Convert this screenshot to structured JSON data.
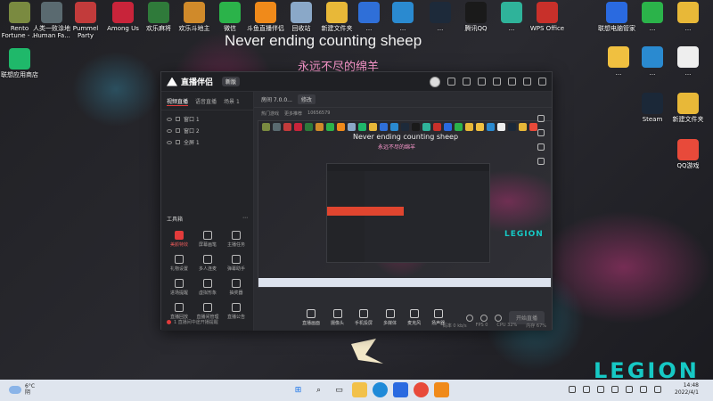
{
  "desktop": {
    "banner_en": "Never ending counting sheep",
    "banner_cn": "永远不尽的绵羊",
    "brand": "LEGION",
    "icons_left": [
      {
        "label": "Rento Fortune - ...",
        "icon": "rento-fortune-icon",
        "color": "#7a8a40"
      },
      {
        "label": "人类一败涂地 Human Fa...",
        "icon": "human-fall-flat-icon",
        "color": "#5a6a70"
      },
      {
        "label": "Pummel Party",
        "icon": "pummel-party-icon",
        "color": "#c23b3b"
      },
      {
        "label": "Among Us",
        "icon": "among-us-icon",
        "color": "#c8243a"
      },
      {
        "label": "欢乐麻将",
        "icon": "mahjong-icon",
        "color": "#2f7a3a"
      },
      {
        "label": "欢乐斗地主",
        "icon": "doudizhu-icon",
        "color": "#d08a2a"
      },
      {
        "label": "微信",
        "icon": "wechat-icon",
        "color": "#2bb34a"
      },
      {
        "label": "斗鱼直播伴侣",
        "icon": "douyu-icon",
        "color": "#f08a1a"
      },
      {
        "label": "回收站",
        "icon": "recycle-bin-icon",
        "color": "#8aa8c8"
      },
      {
        "label": "联想应用商店",
        "icon": "lenovo-store-icon",
        "color": "#1fb86a"
      }
    ],
    "icons_right": [
      {
        "label": "新建文件夹",
        "icon": "folder-icon",
        "color": "#e8b838"
      },
      {
        "label": "...",
        "icon": "app-icon",
        "color": "#2f6fd8"
      },
      {
        "label": "...",
        "icon": "app-icon",
        "color": "#2a8ad0"
      },
      {
        "label": "...",
        "icon": "app-icon",
        "color": "#1d2a3a"
      },
      {
        "label": "腾讯QQ",
        "icon": "qq-icon",
        "color": "#1a1a1a"
      },
      {
        "label": "...",
        "icon": "fb-icon",
        "color": "#2fb39a"
      },
      {
        "label": "WPS Office",
        "icon": "wps-icon",
        "color": "#c8302a"
      },
      {
        "label": "联想电脑管家",
        "icon": "lenovo-manager-icon",
        "color": "#2a6ae0"
      },
      {
        "label": "...",
        "icon": "app-icon",
        "color": "#2bb34a"
      },
      {
        "label": "...",
        "icon": "folder-icon",
        "color": "#e8b838"
      },
      {
        "label": "...",
        "icon": "app-icon",
        "color": "#f0c040"
      },
      {
        "label": "...",
        "icon": "app-icon",
        "color": "#2a8ad0"
      },
      {
        "label": "...",
        "icon": "app-icon",
        "color": "#eeeeee"
      },
      {
        "label": "Steam",
        "icon": "steam-icon",
        "color": "#1b2838"
      },
      {
        "label": "新建文件夹",
        "icon": "folder-icon",
        "color": "#e8b838"
      },
      {
        "label": "QQ游戏",
        "icon": "qq-games-icon",
        "color": "#e84a3a"
      }
    ]
  },
  "app": {
    "name": "直播伴侣",
    "version_badge": "新版",
    "scene_tabs": [
      "视频直播",
      "语音直播",
      "场景 1"
    ],
    "scenes": [
      "窗口 1",
      "窗口 2",
      "全屏 1"
    ],
    "room_title": "房间 7.0.0...",
    "room_btn": "修改",
    "sub_items": [
      "热门游戏",
      "更多推荐",
      "10656579"
    ],
    "tools_title": "工具箱",
    "tools": [
      "美颜特效",
      "屏幕画笔",
      "主播任务",
      "礼物设置",
      "多人连麦",
      "弹幕助手",
      "进场提醒",
      "虚拟形象",
      "抽奖器",
      "直播回放",
      "直播间管理",
      "直播公告"
    ],
    "notice": "1 直播间中途开播提醒",
    "bottom_tools": [
      "直播画面",
      "摄像头",
      "手机投屏",
      "多媒体",
      "麦克风",
      "扬声器"
    ],
    "start_label": "开始直播",
    "status": [
      "码率 0 kb/s",
      "FPS 0",
      "CPU 32%",
      "内存 67%"
    ]
  },
  "taskbar": {
    "weather_temp": "6°C",
    "weather_desc": "阴",
    "time": "14:48",
    "date": "2022/4/1"
  }
}
